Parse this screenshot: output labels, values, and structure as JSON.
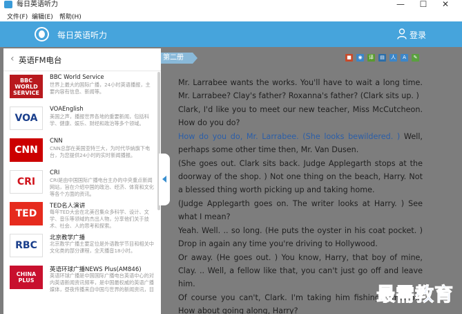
{
  "window": {
    "title": "每日英语听力",
    "controls": [
      "—",
      "☐",
      "✕"
    ]
  },
  "menu": [
    "文件(F)",
    "编辑(E)",
    "帮助(H)"
  ],
  "header": {
    "app_name": "每日英语听力",
    "login": "登录"
  },
  "panel": {
    "title": "英语FM电台",
    "stations": [
      {
        "name": "BBC World Service",
        "logo": "BBC WORLD SERVICE",
        "desc": "世界上最大的国际广播，24小时英语播报，主要内容有信息、新闻等。",
        "colors": {
          "bg": "#b8191e",
          "fg": "#ffffff"
        }
      },
      {
        "name": "VOAEnglish",
        "logo": "VOA",
        "desc": "美国之声，播报世界各地的重要新闻，包括科学、健康、娱乐、财经和政治等多个领域。",
        "colors": {
          "bg": "#ffffff",
          "fg": "#1a3f8c"
        }
      },
      {
        "name": "CNN",
        "logo": "CNN",
        "desc": "CNN总部在美国亚特兰大，为时代华纳旗下电台，为您提供24小时的实时新闻播报。",
        "colors": {
          "bg": "#cc0000",
          "fg": "#ffffff"
        }
      },
      {
        "name": "CRI",
        "logo": "CRI",
        "desc": "CRI是由中国国际广播电台主办的中央重点新闻网站，旨在介绍中国的政治、经济、体育和文化等各个方面的资讯。",
        "colors": {
          "bg": "#ffffff",
          "fg": "#d0121b"
        }
      },
      {
        "name": "TED名人演讲",
        "logo": "TED",
        "desc": "每年TED大会在北美召集众多科学、设计、文学、音乐等领域的杰出人物，分享他们关于技术、社会、人的思考和探索。",
        "colors": {
          "bg": "#e62b1e",
          "fg": "#ffffff"
        }
      },
      {
        "name": "北京教学广播",
        "logo": "RBC",
        "desc": "北京教学广播主要定位是外语教学节目和相关中文化类的部分课程，全天播音18小时。",
        "colors": {
          "bg": "#ffffff",
          "fg": "#1a3f8c"
        }
      },
      {
        "name": "英语环球广播NEWS Plus(AM846)",
        "logo": "CHINA PLUS",
        "desc": "英语环球广播是中国国际广播电台英语中心的对内英语新闻资讯频率，是中国最权威的英语广播媒体，昼夜传播来自中国与世界的新闻资讯，目前覆盖全球57个国家和地区，在世界主要城市均可收听。",
        "colors": {
          "bg": "#c8102e",
          "fg": "#ffffff"
        }
      }
    ]
  },
  "chapter_tab": "第二册",
  "tool_icons": [
    {
      "name": "film-icon",
      "color": "#c84a2a",
      "glyph": "■"
    },
    {
      "name": "audio-icon",
      "color": "#3c86c8",
      "glyph": "◉"
    },
    {
      "name": "translate-icon",
      "color": "#5a9a30",
      "glyph": "译"
    },
    {
      "name": "book-icon",
      "color": "#2d6ea8",
      "glyph": "▤"
    },
    {
      "name": "person-icon",
      "color": "#3c86c8",
      "glyph": "人"
    },
    {
      "name": "text-icon",
      "color": "#3c86c8",
      "glyph": "A"
    },
    {
      "name": "settings-icon",
      "color": "#5aa040",
      "glyph": "✎"
    }
  ],
  "reader": {
    "paragraphs": [
      {
        "text": "Mr. Larrabee wants the works. You'll have to wait a long time. Mr. Larrabee? Clay's father? Roxanna's father? (Clark sits up. )",
        "highlight": ""
      },
      {
        "text": "Clark, I'd like you to meet our new teacher, Miss McCutcheon. How do you do?",
        "highlight": ""
      },
      {
        "text": " Well, perhaps some other time then, Mr. Van Dusen.",
        "highlight": "How do you do, Mr. Larrabee. (She looks bewildered. )"
      },
      {
        "text": "(She goes out. Clark sits back. Judge Applegarth stops at the doorway of the shop. ) Not one thing on the beach, Harry. Not a blessed thing worth picking up and taking home.",
        "highlight": ""
      },
      {
        "text": "(Judge Applegarth goes on. The writer looks at Harry. ) See what I mean?",
        "highlight": ""
      },
      {
        "text": "Yeah. Well. .. so long. (He puts the oyster in his coat pocket. ) Drop in again any time you're driving to Hollywood.",
        "highlight": ""
      },
      {
        "text": "Or away. (He goes out. ) You know, Harry, that boy of mine, Clay. .. Well, a fellow like that, you can't just go off and leave him.",
        "highlight": ""
      },
      {
        "text": "Of course you can't, Clark. I'm taking him fishing tomorrow. How about going along, Harry?",
        "highlight": ""
      }
    ]
  },
  "watermark": "最需教育"
}
